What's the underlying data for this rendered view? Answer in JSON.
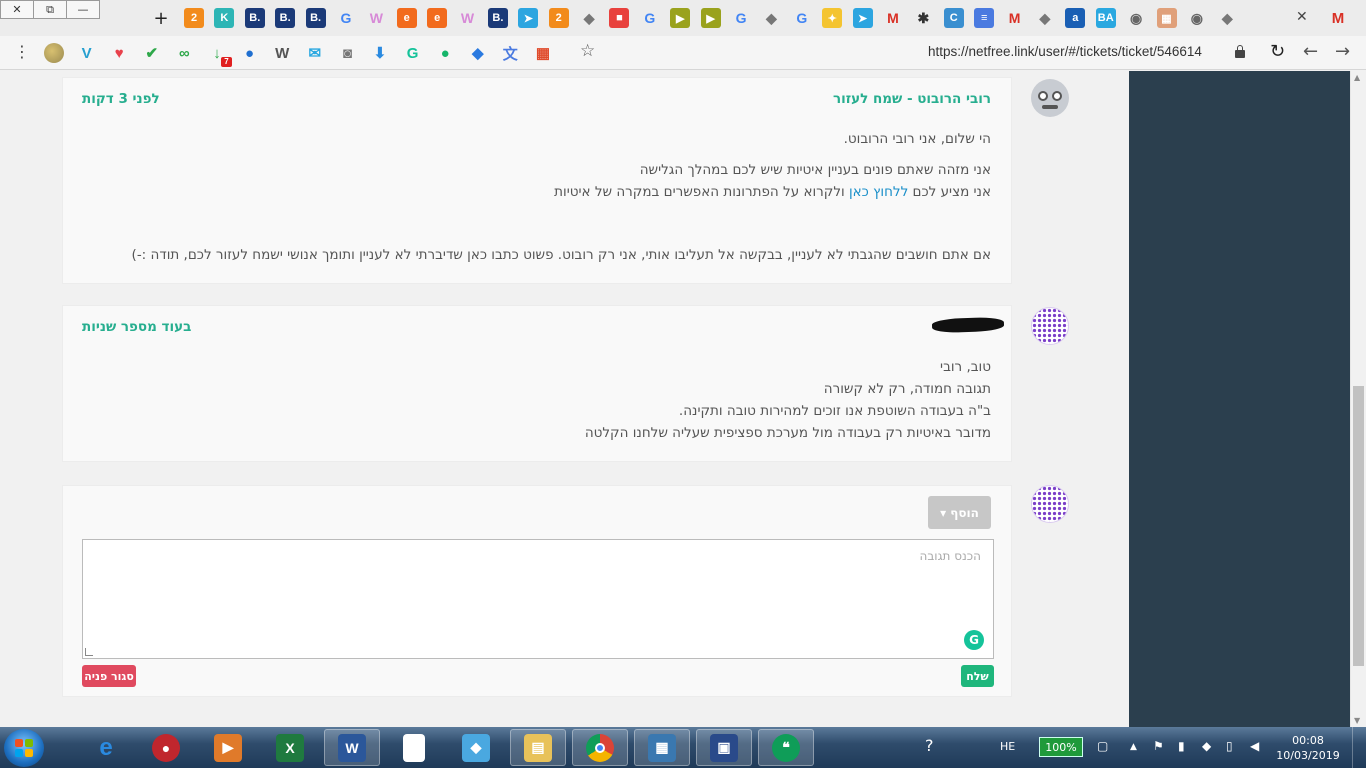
{
  "browser": {
    "url": "https://netfree.link/user/#/tickets/ticket/546614",
    "new_tab_symbol": "+",
    "tab_close_symbol": "✕",
    "window_buttons": [
      "✕",
      "⧉",
      "—"
    ],
    "tab_icons": [
      {
        "name": "tab-icon-2",
        "glyph": "2",
        "color": "#f28b1c"
      },
      {
        "name": "tab-icon-k",
        "glyph": "K",
        "color": "#2db5b5"
      },
      {
        "name": "tab-icon-b1",
        "glyph": "B.",
        "color": "#1b3a78"
      },
      {
        "name": "tab-icon-b2",
        "glyph": "B.",
        "color": "#1b3a78"
      },
      {
        "name": "tab-icon-b3",
        "glyph": "B.",
        "color": "#1b3a78"
      },
      {
        "name": "tab-icon-google1",
        "glyph": "G",
        "color": "#4285f4"
      },
      {
        "name": "tab-icon-w1",
        "glyph": "W",
        "color": "#d78ad7"
      },
      {
        "name": "tab-icon-e1",
        "glyph": "e",
        "color": "#f26b1d"
      },
      {
        "name": "tab-icon-e2",
        "glyph": "e",
        "color": "#f26b1d"
      },
      {
        "name": "tab-icon-w2",
        "glyph": "W",
        "color": "#d78ad7"
      },
      {
        "name": "tab-icon-b4",
        "glyph": "B.",
        "color": "#1b3a78"
      },
      {
        "name": "tab-icon-telegram1",
        "glyph": "➤",
        "color": "#2ca5e0"
      },
      {
        "name": "tab-icon-2b",
        "glyph": "2",
        "color": "#f28b1c"
      },
      {
        "name": "tab-icon-shield1",
        "glyph": "◆",
        "color": "#777777"
      },
      {
        "name": "tab-icon-red",
        "glyph": "■",
        "color": "#e8413d"
      },
      {
        "name": "tab-icon-google2",
        "glyph": "G",
        "color": "#4285f4"
      },
      {
        "name": "tab-icon-play1",
        "glyph": "▶",
        "color": "#9aa21d"
      },
      {
        "name": "tab-icon-play2",
        "glyph": "▶",
        "color": "#9aa21d"
      },
      {
        "name": "tab-icon-google3",
        "glyph": "G",
        "color": "#4285f4"
      },
      {
        "name": "tab-icon-shield2",
        "glyph": "◆",
        "color": "#777777"
      },
      {
        "name": "tab-icon-google4",
        "glyph": "G",
        "color": "#4285f4"
      },
      {
        "name": "tab-icon-bulb",
        "glyph": "✦",
        "color": "#f4c430"
      },
      {
        "name": "tab-icon-telegram2",
        "glyph": "➤",
        "color": "#2ca5e0"
      },
      {
        "name": "tab-icon-gmail1",
        "glyph": "M",
        "color": "#d93025"
      },
      {
        "name": "tab-icon-gear",
        "glyph": "✱",
        "color": "#333333"
      },
      {
        "name": "tab-icon-c",
        "glyph": "C",
        "color": "#3a8fd0"
      },
      {
        "name": "tab-icon-docs",
        "glyph": "≡",
        "color": "#4a7ae0"
      },
      {
        "name": "tab-icon-gmail2",
        "glyph": "M",
        "color": "#d93025"
      },
      {
        "name": "tab-icon-shield3",
        "glyph": "◆",
        "color": "#777777"
      },
      {
        "name": "tab-icon-a",
        "glyph": "a",
        "color": "#1a5fb4"
      },
      {
        "name": "tab-icon-ba",
        "glyph": "BA",
        "color": "#2aa8e0"
      },
      {
        "name": "tab-icon-circle1",
        "glyph": "◉",
        "color": "#666666"
      },
      {
        "name": "tab-icon-photo",
        "glyph": "▦",
        "color": "#e0a07a"
      },
      {
        "name": "tab-icon-circle2",
        "glyph": "◉",
        "color": "#666666"
      },
      {
        "name": "tab-icon-shield4",
        "glyph": "◆",
        "color": "#777777"
      }
    ],
    "extension_icons": [
      {
        "name": "ext-avatar",
        "glyph": "",
        "color": "#9a8a50"
      },
      {
        "name": "ext-v",
        "glyph": "V",
        "color": "#27a0d0"
      },
      {
        "name": "ext-pocket",
        "glyph": "♥",
        "color": "#e8414b"
      },
      {
        "name": "ext-check",
        "glyph": "✔",
        "color": "#2ea84a"
      },
      {
        "name": "ext-link",
        "glyph": "∞",
        "color": "#2ea84a"
      },
      {
        "name": "ext-download",
        "glyph": "↓",
        "color": "#2ea84a",
        "badge": "7"
      },
      {
        "name": "ext-user",
        "glyph": "●",
        "color": "#1f6fd0"
      },
      {
        "name": "ext-wordpress",
        "glyph": "W",
        "color": "#555555"
      },
      {
        "name": "ext-mail",
        "glyph": "✉",
        "color": "#2aa8e0"
      },
      {
        "name": "ext-camera",
        "glyph": "◙",
        "color": "#777777"
      },
      {
        "name": "ext-save",
        "glyph": "⬇",
        "color": "#2a8ae0"
      },
      {
        "name": "ext-grammarly",
        "glyph": "G",
        "color": "#15c39a"
      },
      {
        "name": "ext-bubble",
        "glyph": "●",
        "color": "#15b56a"
      },
      {
        "name": "ext-dropbox",
        "glyph": "◆",
        "color": "#2a7ae0"
      },
      {
        "name": "ext-translate",
        "glyph": "文",
        "color": "#4a7ae0"
      },
      {
        "name": "ext-windows",
        "glyph": "▦",
        "color": "#e04a2a"
      }
    ]
  },
  "ticket": {
    "messages": [
      {
        "author": "רובי הרובוט - שמח לעזור",
        "time": "לפני 3 דקות",
        "greeting": "הי שלום, אני רובי הרובוט.",
        "line1": "אני מזהה שאתם פונים בעניין איטיות שיש לכם במהלך הגלישה",
        "line2_before": "אני מציע לכם ",
        "line2_link": "ללחוץ כאן",
        "line2_after": " ולקרוא על הפתרונות האפשרים במקרה של איטיות",
        "footer": "אם אתם חושבים שהגבתי לא לעניין, בבקשה אל תעליבו אותי, אני רק רובוט. פשוט כתבו כאן שדיברתי לא לעניין ותומך אנושי ישמח לעזור לכם, תודה :-)"
      },
      {
        "time": "בעוד מספר שניות",
        "lines": [
          "טוב, רובי",
          "תגובה חמודה, רק לא קשורה",
          "ב\"ה בעבודה השוטפת אנו זוכים למהירות טובה ותקינה.",
          "מדובר באיטיות רק בעבודה מול מערכת ספציפית שעליה שלחנו הקלטה"
        ]
      }
    ],
    "reply": {
      "add_label": "הוסף ▾",
      "placeholder": "הכנס תגובה",
      "send_label": "שלח",
      "close_label": "סגור פניה"
    }
  },
  "taskbar": {
    "lang": "HE",
    "battery": "100%",
    "time": "00:08",
    "date": "10/03/2019"
  }
}
